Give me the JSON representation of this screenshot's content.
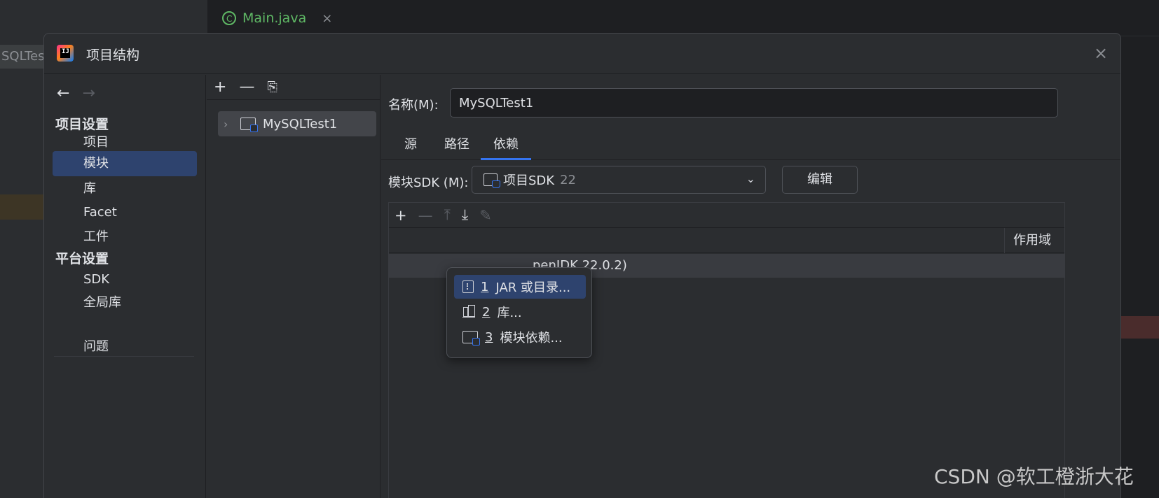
{
  "ide": {
    "left_tab_label": "SQLTest",
    "editor_tab": {
      "label": "Main.java",
      "close": "×"
    }
  },
  "dialog": {
    "title": "项目结构",
    "close": "×"
  },
  "nav": {
    "back": "←",
    "forward": "→",
    "project_settings_header": "项目设置",
    "items_project": [
      "项目",
      "模块",
      "库",
      "Facet",
      "工件"
    ],
    "platform_settings_header": "平台设置",
    "items_platform": [
      "SDK",
      "全局库"
    ],
    "problems": "问题",
    "selected": "模块"
  },
  "tree": {
    "toolbar": {
      "add": "+",
      "remove": "—",
      "copy": "⎘"
    },
    "module": "MySQLTest1"
  },
  "module": {
    "name_label": "名称(M):",
    "name_value": "MySQLTest1",
    "tabs": [
      "源",
      "路径",
      "依赖"
    ],
    "active_tab": "依赖",
    "sdk_label": "模块SDK (M):",
    "sdk_value": "项目SDK",
    "sdk_version": "22",
    "edit_button": "编辑"
  },
  "dependencies": {
    "toolbar": {
      "add": "+",
      "remove": "—",
      "up": "⤒",
      "down": "⤓",
      "edit": "✎"
    },
    "scope_header": "作用域",
    "row_text": "penJDK 22.0.2)"
  },
  "popup": {
    "items": [
      {
        "num": "1",
        "label": "JAR 或目录..."
      },
      {
        "num": "2",
        "label": "库..."
      },
      {
        "num": "3",
        "label": "模块依赖..."
      }
    ]
  },
  "watermark": "CSDN @软工橙浙大花"
}
